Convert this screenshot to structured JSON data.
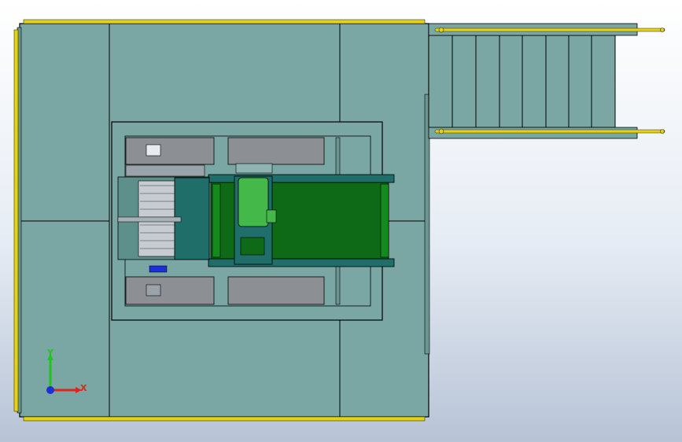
{
  "viewport": {
    "background_top": "#ffffff",
    "background_bottom": "#b7c3d6"
  },
  "model": {
    "platform_color": "#7aa7a3",
    "frame_color": "#000000",
    "railing_color": "#e3d21a",
    "belt_color": "#0e6a16",
    "belt_frame_color": "#1f6e6a",
    "motor_color": "#45b84a",
    "opening_color": "#8c8f93"
  },
  "triad": {
    "x_label": "X",
    "y_label": "Y",
    "x_color": "#e0241b",
    "y_color": "#22c41f",
    "z_color": "#1c2fd8"
  }
}
